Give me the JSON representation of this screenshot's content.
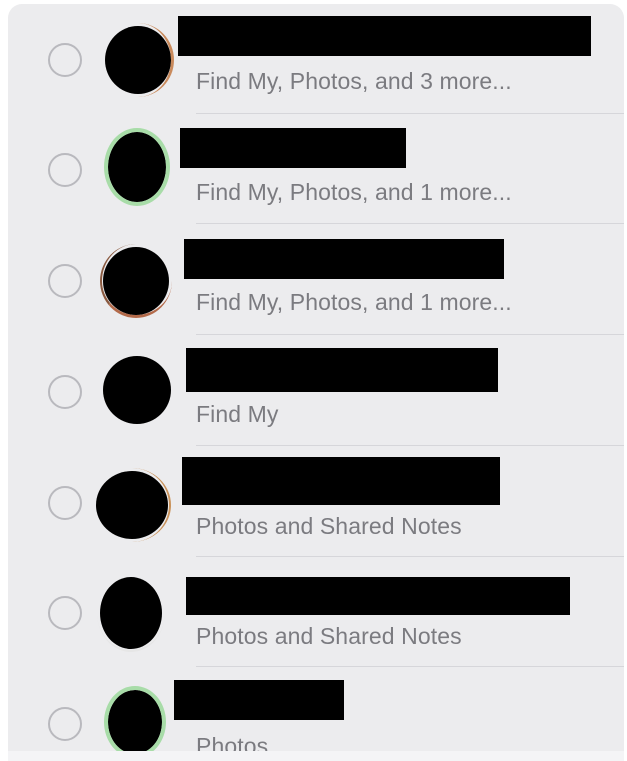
{
  "colors": {
    "panel_background": "#ececee",
    "subtitle_text": "#7b7b80",
    "radio_border": "#b9b9be",
    "divider": "#d6d6da",
    "redaction": "#000000"
  },
  "people": [
    {
      "subtitle": "Find My, Photos, and 3 more...",
      "selected": false,
      "avatar_icon": "person-avatar"
    },
    {
      "subtitle": "Find My, Photos, and 1 more...",
      "selected": false,
      "avatar_icon": "person-avatar"
    },
    {
      "subtitle": "Find My, Photos, and 1 more...",
      "selected": false,
      "avatar_icon": "person-avatar"
    },
    {
      "subtitle": "Find My",
      "selected": false,
      "avatar_icon": "person-avatar"
    },
    {
      "subtitle": "Photos and Shared Notes",
      "selected": false,
      "avatar_icon": "person-avatar"
    },
    {
      "subtitle": "Photos and Shared Notes",
      "selected": false,
      "avatar_icon": "person-avatar"
    },
    {
      "subtitle": "Photos",
      "selected": false,
      "avatar_icon": "person-avatar"
    }
  ]
}
